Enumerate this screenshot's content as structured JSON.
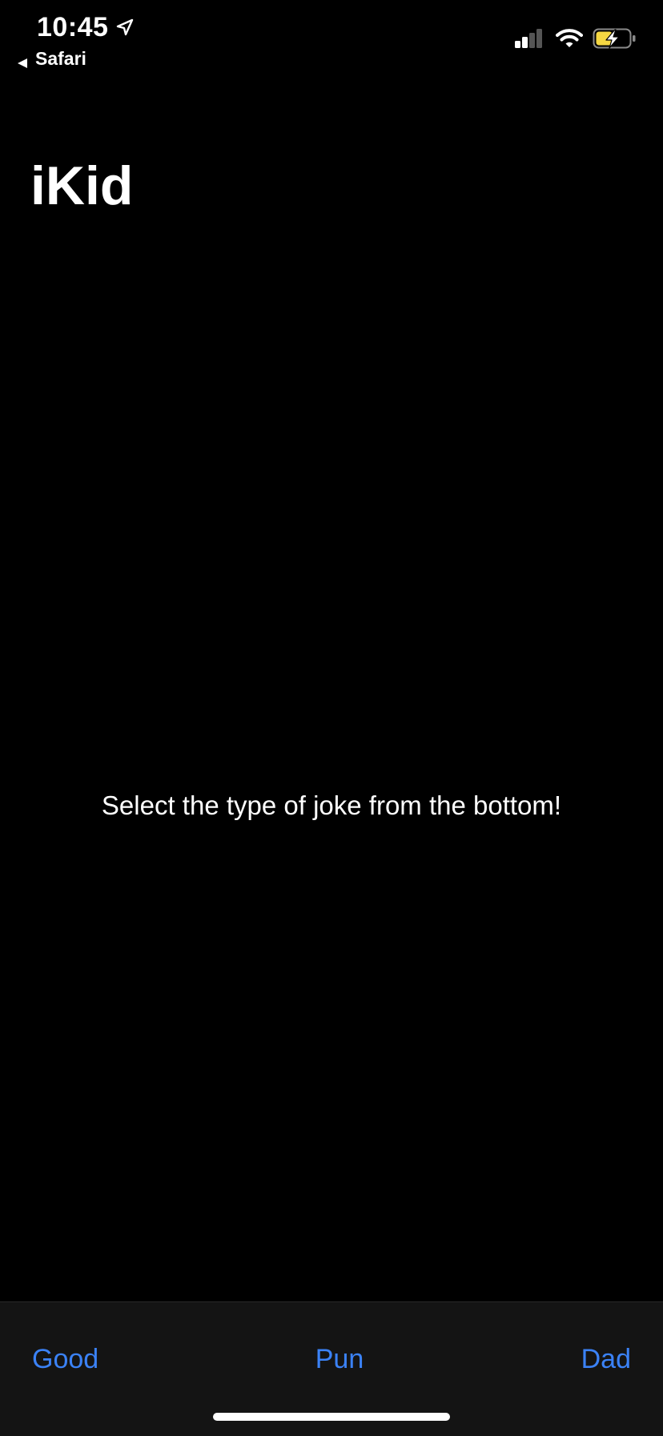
{
  "status_bar": {
    "time": "10:45",
    "back_app": "Safari",
    "icons": [
      "location-arrow-icon",
      "cellular-signal-icon",
      "wifi-icon",
      "battery-charging-icon"
    ]
  },
  "navigation": {
    "title": "iKid"
  },
  "main": {
    "prompt": "Select the type of joke from the bottom!"
  },
  "toolbar": {
    "buttons": [
      {
        "label": "Good"
      },
      {
        "label": "Pun"
      },
      {
        "label": "Dad"
      }
    ]
  },
  "colors": {
    "background": "#000000",
    "toolbar_background": "#141414",
    "accent": "#3b82f6",
    "text": "#ffffff",
    "battery_charging": "#f5d742"
  }
}
